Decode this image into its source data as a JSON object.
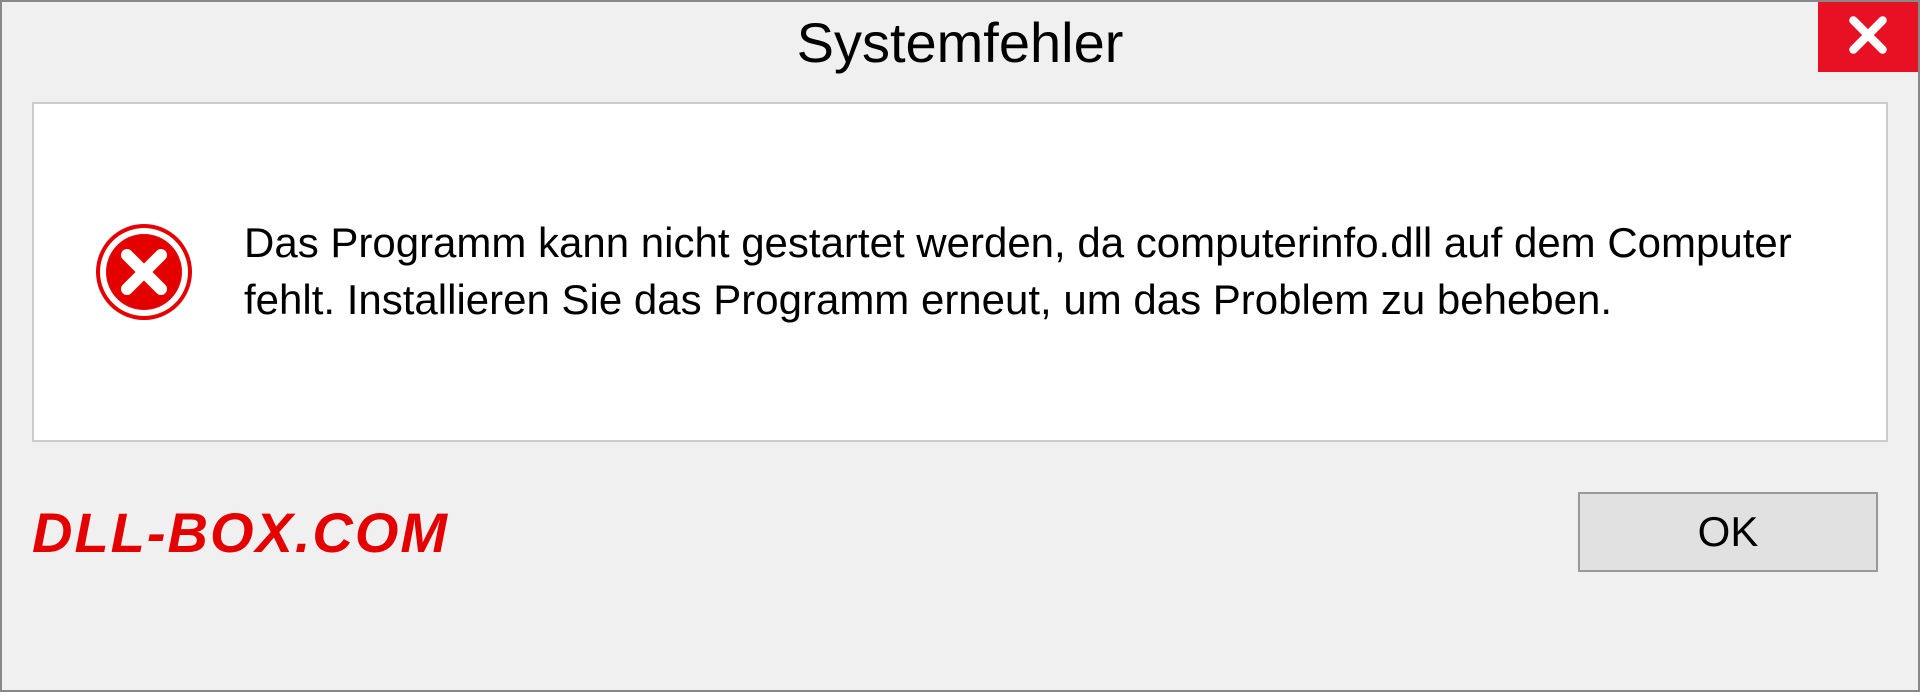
{
  "dialog": {
    "title": "Systemfehler",
    "message": "Das Programm kann nicht gestartet werden, da computerinfo.dll auf dem Computer fehlt. Installieren Sie das Programm erneut, um das Problem zu beheben.",
    "ok_label": "OK"
  },
  "watermark": "DLL-BOX.COM",
  "colors": {
    "error_red": "#e81123",
    "watermark_red": "#e50000"
  }
}
